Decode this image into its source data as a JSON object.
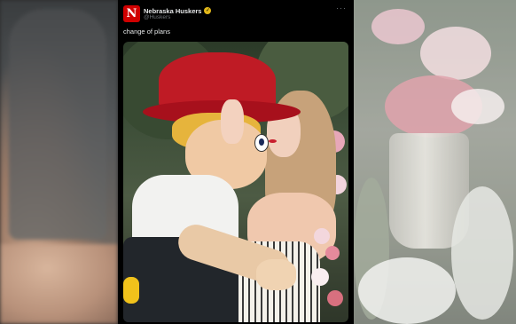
{
  "post": {
    "account_name": "Nebraska Huskers",
    "handle": "@Huskers",
    "avatar_letter": "N",
    "more_label": "···",
    "text": "change of plans",
    "verified_mark": "✓"
  },
  "colors": {
    "avatar_bg": "#d00000",
    "verified_badge": "#e2b719",
    "card_bg": "#000000",
    "text_primary": "#e7e9ea",
    "text_secondary": "#71767b"
  },
  "icons": [
    "nebraska-logo-icon",
    "verified-badge-icon",
    "more-options-icon"
  ]
}
